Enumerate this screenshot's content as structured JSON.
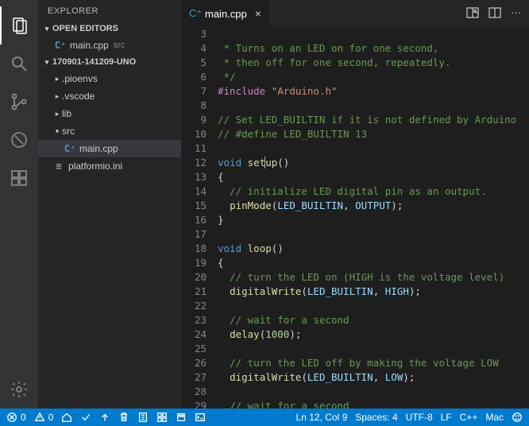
{
  "sidebar": {
    "title": "EXPLORER",
    "openEditors": {
      "header": "OPEN EDITORS",
      "items": [
        {
          "name": "main.cpp",
          "dir": "src"
        }
      ]
    },
    "project": {
      "header": "170901-141209-UNO",
      "tree": [
        {
          "name": ".pioenvs",
          "type": "folder",
          "expanded": false,
          "depth": 1
        },
        {
          "name": ".vscode",
          "type": "folder",
          "expanded": false,
          "depth": 1
        },
        {
          "name": "lib",
          "type": "folder",
          "expanded": false,
          "depth": 1
        },
        {
          "name": "src",
          "type": "folder",
          "expanded": true,
          "depth": 1
        },
        {
          "name": "main.cpp",
          "type": "cpp",
          "depth": 2,
          "selected": true
        },
        {
          "name": "platformio.ini",
          "type": "ini",
          "depth": 1
        }
      ]
    }
  },
  "tab": {
    "name": "main.cpp"
  },
  "code": {
    "start": 3,
    "lines": [
      [],
      [
        {
          "c": "tok-c",
          "t": " * Turns on an LED on for one second,"
        }
      ],
      [
        {
          "c": "tok-c",
          "t": " * then off for one second, repeatedly."
        }
      ],
      [
        {
          "c": "tok-c",
          "t": " */"
        }
      ],
      [
        {
          "c": "tok-pp",
          "t": "#include"
        },
        {
          "c": "tok-p",
          "t": " "
        },
        {
          "c": "tok-s",
          "t": "\"Arduino.h\""
        }
      ],
      [],
      [
        {
          "c": "tok-c",
          "t": "// Set LED_BUILTIN if it is not defined by Arduino"
        }
      ],
      [
        {
          "c": "tok-c",
          "t": "// #define LED_BUILTIN 13"
        }
      ],
      [],
      [
        {
          "c": "tok-k",
          "t": "void"
        },
        {
          "c": "tok-p",
          "t": " "
        },
        {
          "c": "tok-fn",
          "t": "set"
        },
        {
          "c": "cursor",
          "t": ""
        },
        {
          "c": "tok-fn",
          "t": "up"
        },
        {
          "c": "tok-p",
          "t": "()"
        }
      ],
      [
        {
          "c": "tok-p",
          "t": "{"
        }
      ],
      [
        {
          "c": "tok-p",
          "t": "  "
        },
        {
          "c": "tok-c",
          "t": "// initialize LED digital pin as an output."
        }
      ],
      [
        {
          "c": "tok-p",
          "t": "  "
        },
        {
          "c": "tok-fn",
          "t": "pinMode"
        },
        {
          "c": "tok-p",
          "t": "("
        },
        {
          "c": "tok-id",
          "t": "LED_BUILTIN"
        },
        {
          "c": "tok-p",
          "t": ", "
        },
        {
          "c": "tok-id",
          "t": "OUTPUT"
        },
        {
          "c": "tok-p",
          "t": ");"
        }
      ],
      [
        {
          "c": "tok-p",
          "t": "}"
        }
      ],
      [],
      [
        {
          "c": "tok-k",
          "t": "void"
        },
        {
          "c": "tok-p",
          "t": " "
        },
        {
          "c": "tok-fn",
          "t": "loop"
        },
        {
          "c": "tok-p",
          "t": "()"
        }
      ],
      [
        {
          "c": "tok-p",
          "t": "{"
        }
      ],
      [
        {
          "c": "tok-p",
          "t": "  "
        },
        {
          "c": "tok-c",
          "t": "// turn the LED on (HIGH is the voltage level)"
        }
      ],
      [
        {
          "c": "tok-p",
          "t": "  "
        },
        {
          "c": "tok-fn",
          "t": "digitalWrite"
        },
        {
          "c": "tok-p",
          "t": "("
        },
        {
          "c": "tok-id",
          "t": "LED_BUILTIN"
        },
        {
          "c": "tok-p",
          "t": ", "
        },
        {
          "c": "tok-id",
          "t": "HIGH"
        },
        {
          "c": "tok-p",
          "t": ");"
        }
      ],
      [],
      [
        {
          "c": "tok-p",
          "t": "  "
        },
        {
          "c": "tok-c",
          "t": "// wait for a second"
        }
      ],
      [
        {
          "c": "tok-p",
          "t": "  "
        },
        {
          "c": "tok-fn",
          "t": "delay"
        },
        {
          "c": "tok-p",
          "t": "("
        },
        {
          "c": "tok-n",
          "t": "1000"
        },
        {
          "c": "tok-p",
          "t": ");"
        }
      ],
      [],
      [
        {
          "c": "tok-p",
          "t": "  "
        },
        {
          "c": "tok-c",
          "t": "// turn the LED off by making the voltage LOW"
        }
      ],
      [
        {
          "c": "tok-p",
          "t": "  "
        },
        {
          "c": "tok-fn",
          "t": "digitalWrite"
        },
        {
          "c": "tok-p",
          "t": "("
        },
        {
          "c": "tok-id",
          "t": "LED_BUILTIN"
        },
        {
          "c": "tok-p",
          "t": ", "
        },
        {
          "c": "tok-id",
          "t": "LOW"
        },
        {
          "c": "tok-p",
          "t": ");"
        }
      ],
      [],
      [
        {
          "c": "tok-p",
          "t": "  "
        },
        {
          "c": "tok-c",
          "t": "// wait for a second"
        }
      ]
    ]
  },
  "status": {
    "errors": "0",
    "warnings": "0",
    "cursor": "Ln 12, Col 9",
    "spaces": "Spaces: 4",
    "encoding": "UTF-8",
    "eol": "LF",
    "lang": "C++",
    "os": "Mac"
  }
}
